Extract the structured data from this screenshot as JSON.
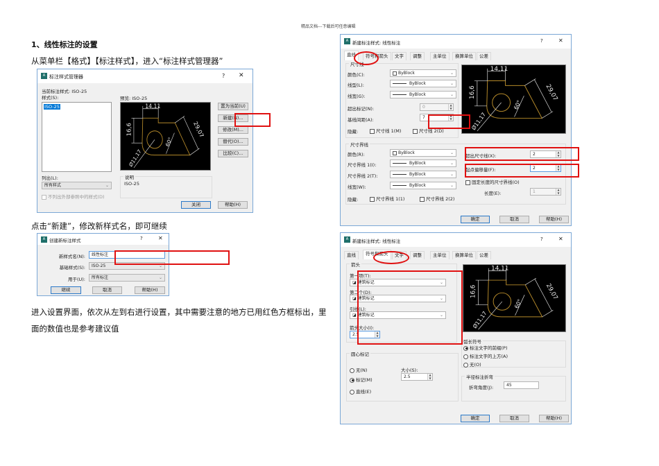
{
  "page_header": "精品文档---下载后可任意编辑",
  "heading": "1、线性标注的设置",
  "para1": "从菜单栏【格式】【标注样式】，进入“标注样式管理器”",
  "para2": "点击“新建”，修改新样式名，即可继续",
  "para3": "进入设置界面，依次从左到右进行设置，其中需要注意的地方已用红色方框标出，里",
  "para4": "面的数值也是参考建议值",
  "common": {
    "help_glyph": "?",
    "close_glyph": "✕",
    "logo": "A",
    "ok": "确定",
    "cancel": "取消",
    "help": "帮助(H)"
  },
  "preview": {
    "top": "14,11",
    "left": "16,6",
    "diag": "29,07",
    "angle": "60°",
    "dia": "Ø11,17"
  },
  "manager": {
    "title": "标注样式管理器",
    "current_style": "当前标注样式: ISO-25",
    "styles_label": "样式(S):",
    "styles": [
      "ISO-25"
    ],
    "preview_label": "预览: ISO-25",
    "buttons": [
      "置为当前(U)",
      "新建(N)...",
      "修改(M)...",
      "替代(O)...",
      "比较(C)..."
    ],
    "list_label": "列出(L):",
    "list_value": "所有样式",
    "xref_checkbox": "不列出外部参照中的样式(D)",
    "desc_label": "说明",
    "desc_value": "ISO-25",
    "close": "关闭",
    "help": "帮助(H)"
  },
  "create": {
    "title": "创建新标注样式",
    "name_label": "新样式名(N):",
    "name_value": "线性标注",
    "base_label": "基础样式(S):",
    "base_value": "ISO-25",
    "use_label": "用于(U):",
    "use_value": "所有标注",
    "continue": "继续",
    "cancel": "取消",
    "help": "帮助(H)"
  },
  "newstyle": {
    "title": "新建标注样式: 线性标注",
    "tabs": [
      "直线",
      "符号和箭头",
      "文字",
      "调整",
      "主单位",
      "换算单位",
      "公差"
    ],
    "dimline": {
      "group": "尺寸线",
      "color_label": "颜色(C):",
      "color_value": "ByBlock",
      "ltype_label": "线型(L):",
      "ltype_value": "ByBlock",
      "lweight_label": "线宽(G):",
      "lweight_value": "ByBlock",
      "extend_label": "超出标记(N):",
      "extend_value": "0",
      "baseline_label": "基线间距(A):",
      "baseline_value": "7",
      "suppress_label": "隐藏:",
      "suppress1": "尺寸线 1(M)",
      "suppress2": "尺寸线 2(D)"
    },
    "extline": {
      "group": "尺寸界线",
      "color_label": "颜色(R):",
      "color_value": "ByBlock",
      "lt1_label": "尺寸界线 1(I):",
      "lt1_value": "ByBlock",
      "lt2_label": "尺寸界线 2(T):",
      "lt2_value": "ByBlock",
      "lweight_label": "线宽(W):",
      "lweight_value": "ByBlock",
      "suppress_label": "隐藏:",
      "suppress1": "尺寸界线 1(1)",
      "suppress2": "尺寸界线 2(2)",
      "beyond_label": "超出尺寸线(X):",
      "beyond_value": "2",
      "offset_label": "起点偏移量(F):",
      "offset_value": "2",
      "fixed_label": "固定长度的尺寸界线(O)",
      "length_label": "长度(E):",
      "length_value": "1"
    },
    "arrows": {
      "group": "箭头",
      "first_label": "第一项(T):",
      "first_value": "建筑标记",
      "second_label": "第二个(D):",
      "second_value": "建筑标记",
      "leader_label": "引线(L):",
      "leader_value": "建筑标记",
      "size_label": "箭头大小(I):",
      "size_value": "2.5"
    },
    "center": {
      "group": "圆心标记",
      "none": "无(N)",
      "mark": "标记(M)",
      "line": "直线(E)",
      "size_label": "大小(S):",
      "size_value": "2.5",
      "selected": "mark"
    },
    "arc": {
      "group": "弧长符号",
      "opt1": "标注文字的前缀(P)",
      "opt2": "标注文字的上方(A)",
      "opt3": "无(O)",
      "selected": "opt1"
    },
    "jog": {
      "group": "半径标注折弯",
      "angle_label": "折弯角度(J):",
      "angle_value": "45"
    }
  }
}
